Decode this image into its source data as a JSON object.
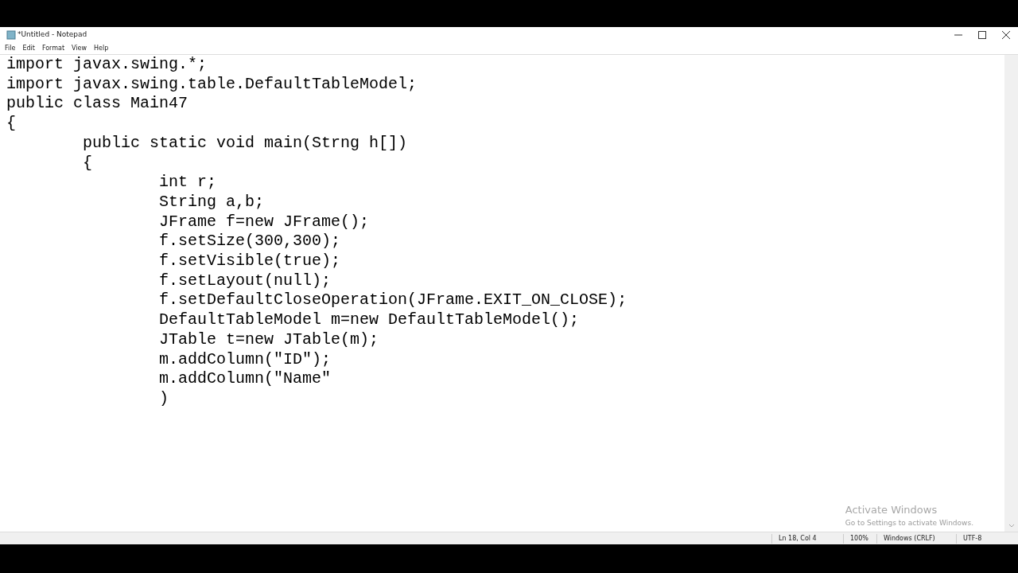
{
  "window": {
    "title": "*Untitled - Notepad"
  },
  "menu": [
    {
      "label": "File"
    },
    {
      "label": "Edit"
    },
    {
      "label": "Format"
    },
    {
      "label": "View"
    },
    {
      "label": "Help"
    }
  ],
  "editor": {
    "lines": [
      "import javax.swing.*;",
      "import javax.swing.table.DefaultTableModel;",
      "public class Main47",
      "{",
      "\tpublic static void main(Strng h[])",
      "\t{",
      "\t\tint r;",
      "\t\tString a,b;",
      "\t\tJFrame f=new JFrame();",
      "\t\tf.setSize(300,300);",
      "\t\tf.setVisible(true);",
      "\t\tf.setLayout(null);",
      "\t\tf.setDefaultCloseOperation(JFrame.EXIT_ON_CLOSE);",
      "\t\tDefaultTableModel m=new DefaultTableModel();",
      "\t\tJTable t=new JTable(m);",
      "\t\tm.addColumn(\"ID\");",
      "\t\tm.addColumn(\"Name\"",
      "\t\t)"
    ]
  },
  "activation": {
    "title": "Activate Windows",
    "message": "Go to Settings to activate Windows."
  },
  "status_bar": [
    "Ln 18, Col 4",
    "100%",
    "Windows (CRLF)",
    "UTF-8"
  ]
}
